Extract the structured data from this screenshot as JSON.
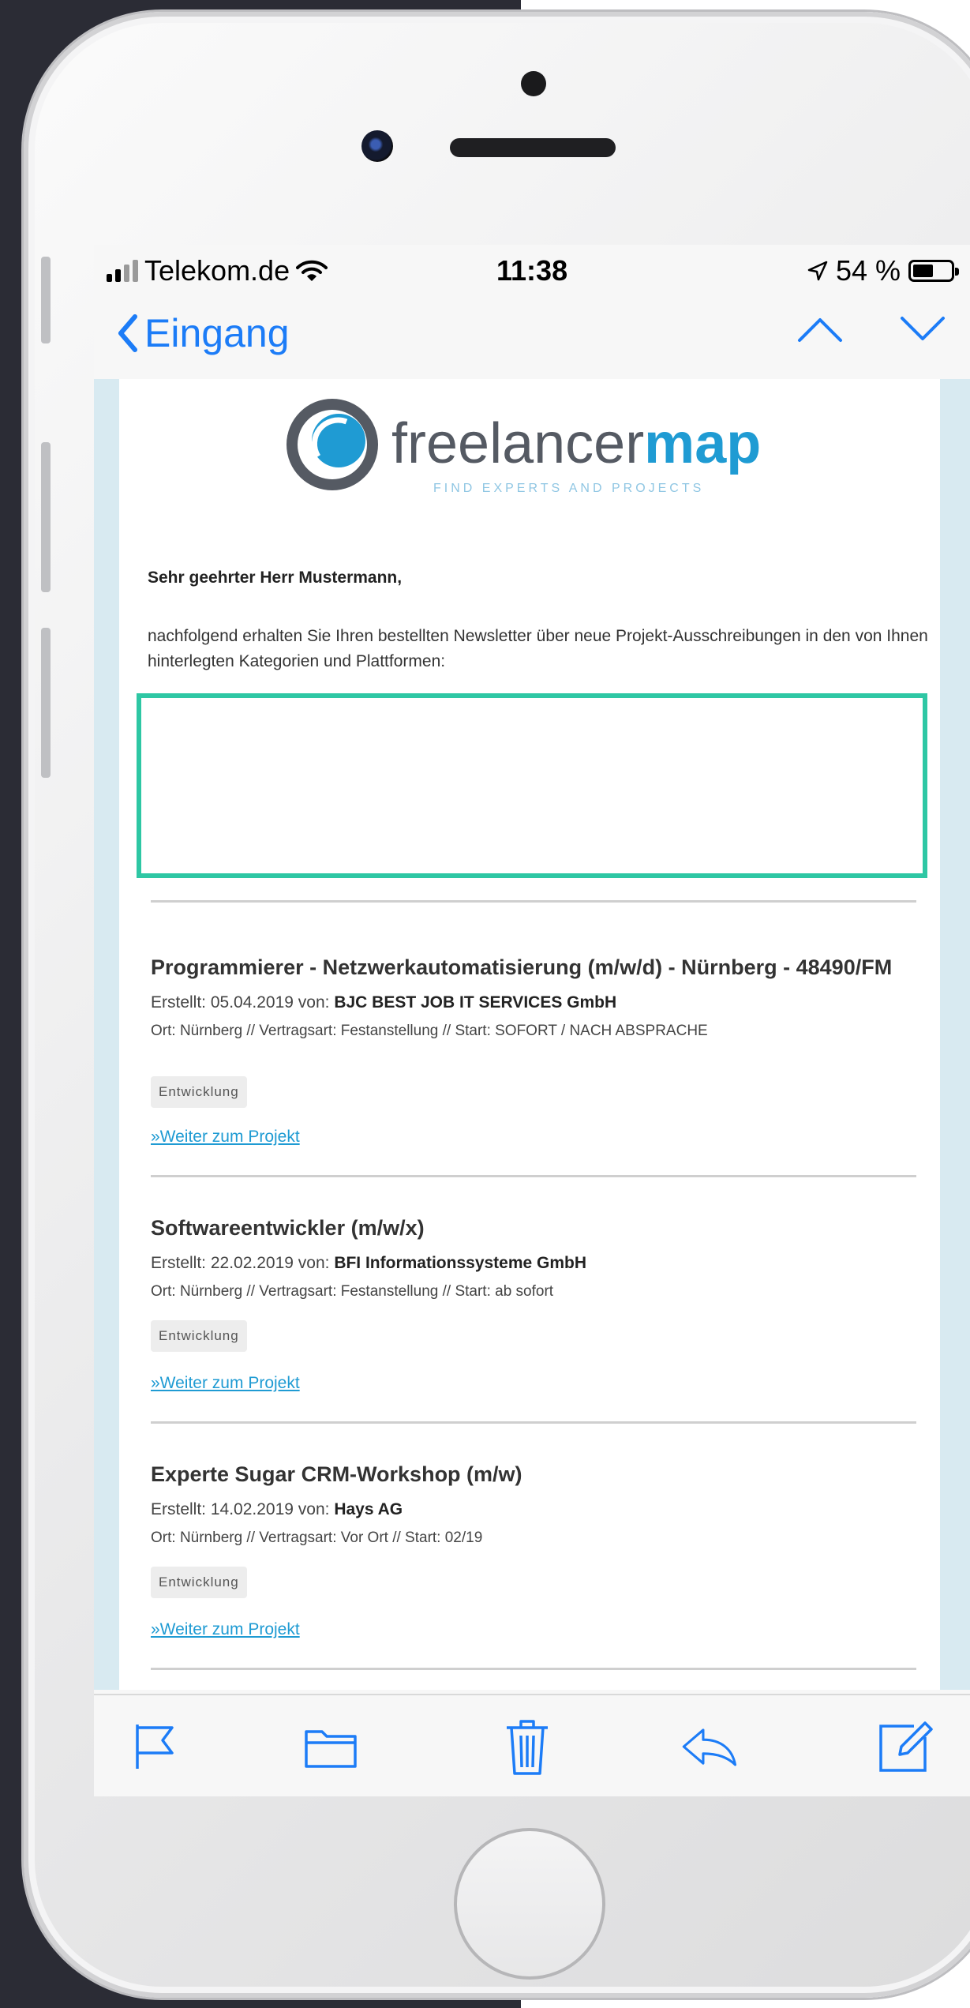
{
  "status_bar": {
    "carrier": "Telekom.de",
    "time": "11:38",
    "battery": "54 %",
    "battery_level": 0.54
  },
  "nav": {
    "back_label": "Eingang"
  },
  "logo": {
    "name_light": "freelancer",
    "name_bold": "map",
    "tagline": "FIND EXPERTS AND PROJECTS",
    "accent_color": "#1f9bd3",
    "ring_color": "#555a63"
  },
  "email": {
    "greeting": "Sehr geehrter Herr Mustermann,",
    "intro": "nachfolgend erhalten Sie Ihren bestellten Newsletter über neue Projekt-Ausschreibungen in den von Ihnen hinterlegten Kategorien und Plattformen:",
    "highlight_color": "#2ec7a4",
    "jobs": [
      {
        "title": "Programmierer - Netzwerkautomatisierung (m/w/d) - Nürnberg - 48490/FM",
        "created_prefix": "Erstellt: 05.04.2019 von: ",
        "company": "BJC BEST JOB IT SERVICES GmbH",
        "location": "Ort: Nürnberg // Vertragsart: Festanstellung // Start: SOFORT / NACH ABSPRACHE",
        "tag": "Entwicklung",
        "link": "»Weiter zum Projekt"
      },
      {
        "title": "Softwareentwickler (m/w/x)",
        "created_prefix": "Erstellt: 22.02.2019 von: ",
        "company": "BFI Informationssysteme GmbH",
        "location": "Ort: Nürnberg // Vertragsart: Festanstellung // Start: ab sofort",
        "tag": "Entwicklung",
        "link": "»Weiter zum Projekt"
      },
      {
        "title": "Experte Sugar CRM-Workshop (m/w)",
        "created_prefix": "Erstellt: 14.02.2019 von: ",
        "company": "Hays AG",
        "location": "Ort: Nürnberg // Vertragsart: Vor Ort // Start: 02/19",
        "tag": "Entwicklung",
        "link": "»Weiter zum Projekt"
      }
    ]
  },
  "toolbar": {
    "icons": [
      "flag-icon",
      "folder-icon",
      "trash-icon",
      "reply-icon",
      "compose-icon"
    ],
    "tint": "#1c7cf7"
  }
}
